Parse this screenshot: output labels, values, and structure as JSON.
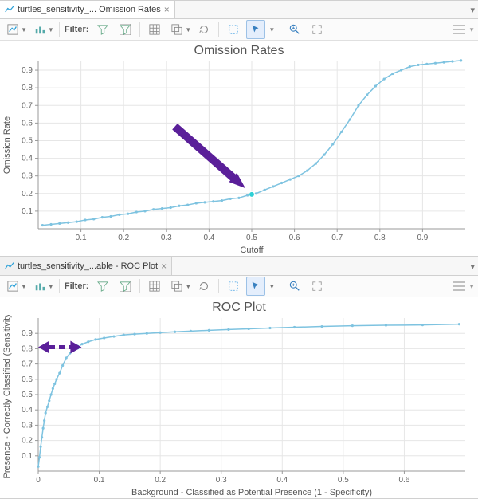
{
  "panes": [
    {
      "tab_label": "turtles_sensitivity_... Omission Rates",
      "toolbar": {
        "filter_label": "Filter:"
      },
      "chart": {
        "title": "Omission Rates",
        "xlabel": "Cutoff",
        "ylabel": "Omission Rate"
      }
    },
    {
      "tab_label": "turtles_sensitivity_...able - ROC Plot",
      "toolbar": {
        "filter_label": "Filter:"
      },
      "chart": {
        "title": "ROC Plot",
        "xlabel": "Background - Classified as Potential Presence (1 - Specificity)",
        "ylabel": "Presence - Correctly Classified (Sensitivity)"
      }
    }
  ],
  "chart_data": [
    {
      "type": "line",
      "title": "Omission Rates",
      "xlabel": "Cutoff",
      "ylabel": "Omission Rate",
      "xlim": [
        0.0,
        1.0
      ],
      "ylim": [
        0.0,
        0.95
      ],
      "xticks": [
        0.1,
        0.2,
        0.3,
        0.4,
        0.5,
        0.6,
        0.7,
        0.8,
        0.9
      ],
      "yticks": [
        0.1,
        0.2,
        0.3,
        0.4,
        0.5,
        0.6,
        0.7,
        0.8,
        0.9
      ],
      "x": [
        0.01,
        0.03,
        0.05,
        0.07,
        0.09,
        0.11,
        0.13,
        0.15,
        0.17,
        0.19,
        0.21,
        0.23,
        0.25,
        0.27,
        0.29,
        0.31,
        0.33,
        0.35,
        0.37,
        0.39,
        0.41,
        0.43,
        0.45,
        0.47,
        0.49,
        0.5,
        0.51,
        0.53,
        0.55,
        0.57,
        0.59,
        0.61,
        0.63,
        0.65,
        0.67,
        0.69,
        0.71,
        0.73,
        0.75,
        0.77,
        0.79,
        0.81,
        0.83,
        0.85,
        0.87,
        0.89,
        0.91,
        0.93,
        0.95,
        0.97,
        0.99
      ],
      "y": [
        0.02,
        0.025,
        0.03,
        0.035,
        0.04,
        0.05,
        0.055,
        0.065,
        0.07,
        0.08,
        0.085,
        0.095,
        0.1,
        0.11,
        0.115,
        0.12,
        0.13,
        0.135,
        0.145,
        0.15,
        0.155,
        0.16,
        0.17,
        0.175,
        0.19,
        0.195,
        0.2,
        0.22,
        0.24,
        0.26,
        0.28,
        0.3,
        0.33,
        0.37,
        0.42,
        0.48,
        0.55,
        0.62,
        0.7,
        0.76,
        0.81,
        0.85,
        0.88,
        0.9,
        0.92,
        0.93,
        0.935,
        0.94,
        0.945,
        0.95,
        0.955
      ],
      "highlight": {
        "x": 0.5,
        "y": 0.195
      },
      "arrow": {
        "type": "solid",
        "from_x": 0.32,
        "from_y": 0.58,
        "to_x": 0.485,
        "to_y": 0.23
      }
    },
    {
      "type": "line",
      "title": "ROC Plot",
      "xlabel": "Background - Classified as Potential Presence (1 - Specificity)",
      "ylabel": "Presence - Correctly Classified (Sensitivity)",
      "xlim": [
        0.0,
        0.7
      ],
      "ylim": [
        0.0,
        1.0
      ],
      "xticks": [
        0,
        0.1,
        0.2,
        0.3,
        0.4,
        0.5,
        0.6
      ],
      "yticks": [
        0.1,
        0.2,
        0.3,
        0.4,
        0.5,
        0.6,
        0.7,
        0.8,
        0.9
      ],
      "x": [
        0.0,
        0.002,
        0.004,
        0.006,
        0.008,
        0.01,
        0.012,
        0.015,
        0.018,
        0.021,
        0.024,
        0.027,
        0.03,
        0.035,
        0.04,
        0.046,
        0.052,
        0.058,
        0.064,
        0.072,
        0.082,
        0.094,
        0.108,
        0.124,
        0.14,
        0.158,
        0.178,
        0.2,
        0.224,
        0.25,
        0.28,
        0.312,
        0.345,
        0.38,
        0.42,
        0.465,
        0.515,
        0.57,
        0.63,
        0.69
      ],
      "y": [
        0.03,
        0.09,
        0.16,
        0.22,
        0.28,
        0.33,
        0.38,
        0.42,
        0.46,
        0.5,
        0.54,
        0.57,
        0.6,
        0.64,
        0.69,
        0.74,
        0.77,
        0.79,
        0.81,
        0.83,
        0.845,
        0.86,
        0.87,
        0.88,
        0.89,
        0.895,
        0.9,
        0.905,
        0.91,
        0.915,
        0.92,
        0.925,
        0.93,
        0.935,
        0.94,
        0.945,
        0.95,
        0.953,
        0.955,
        0.96
      ],
      "highlight": {
        "x": 0.064,
        "y": 0.81
      },
      "arrow": {
        "type": "dashed",
        "y": 0.81,
        "from_x": 0.0,
        "to_x": 0.058
      }
    }
  ]
}
